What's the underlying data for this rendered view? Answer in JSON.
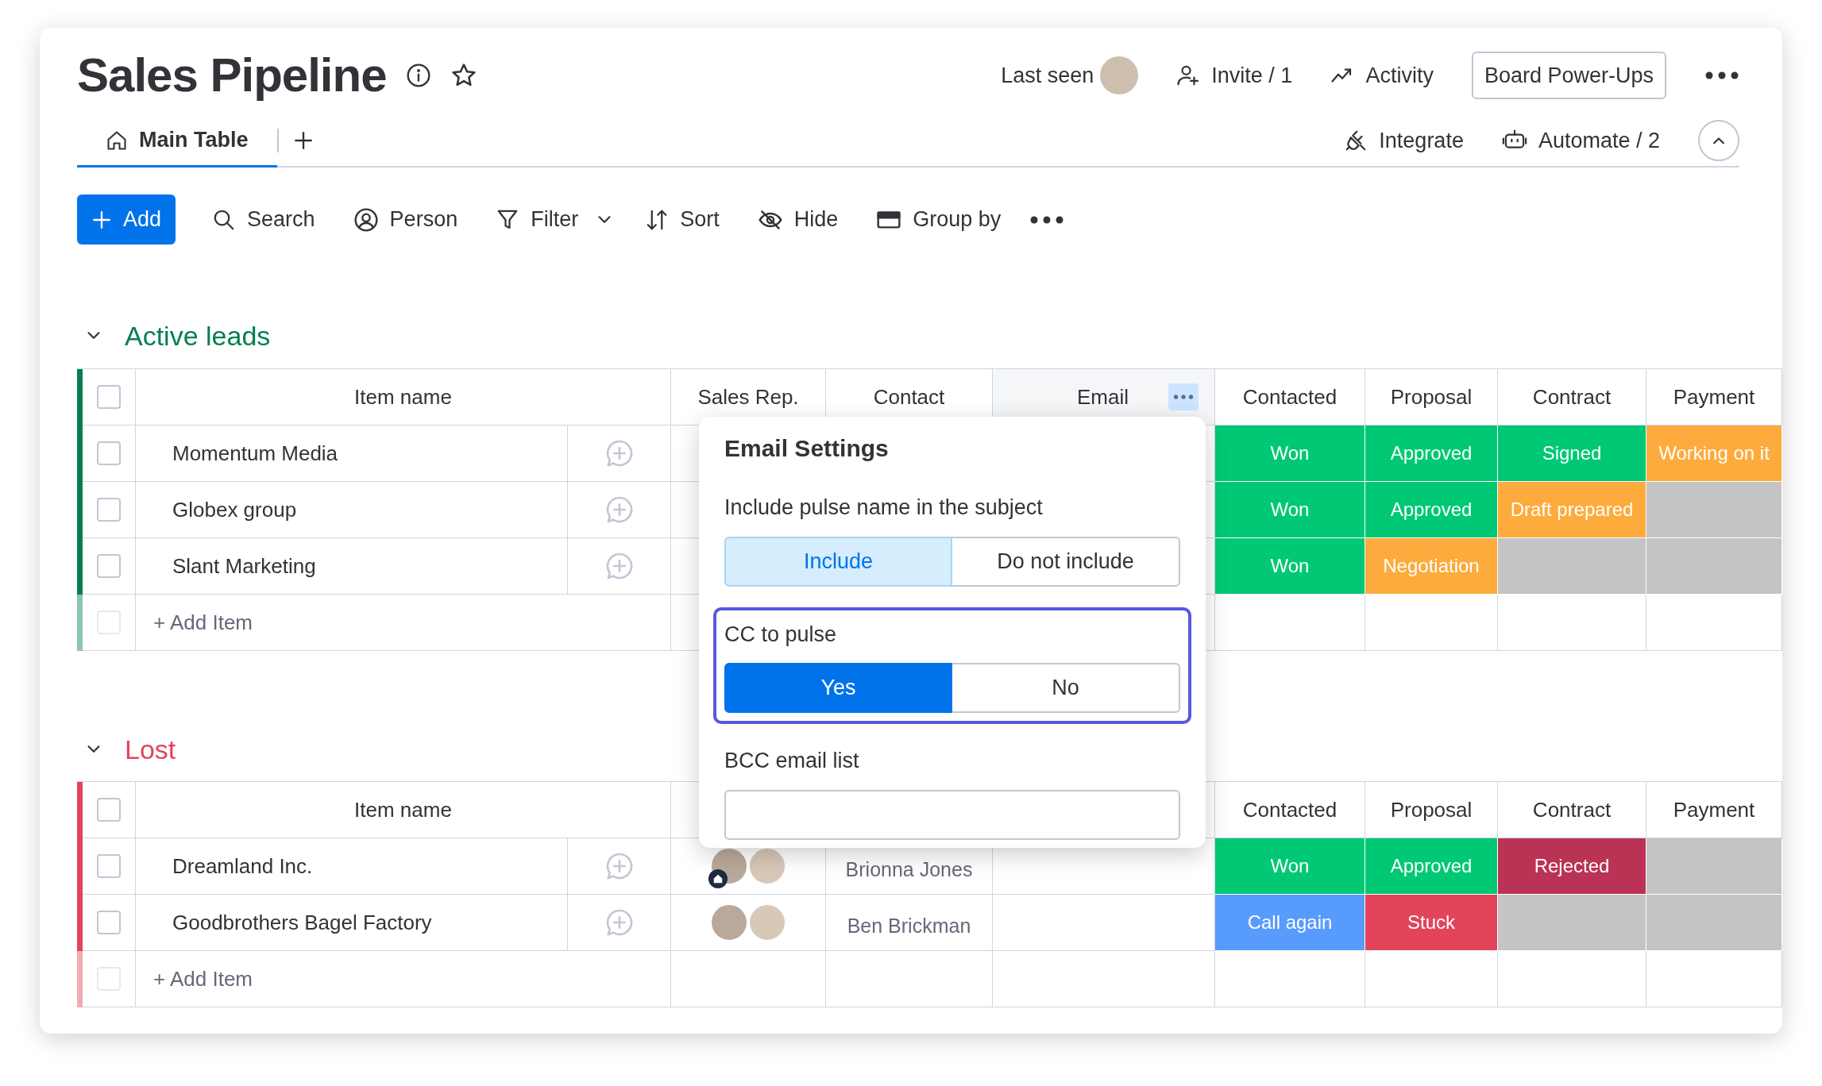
{
  "board": {
    "title": "Sales Pipeline"
  },
  "top_actions": {
    "last_seen": "Last seen",
    "items": [
      {
        "label": "Invite / 1"
      },
      {
        "label": "Activity"
      }
    ],
    "power_ups": "Board Power-Ups"
  },
  "views": [
    {
      "label": "Main Table",
      "selected": true
    }
  ],
  "view_actions": [
    {
      "label": "Integrate"
    },
    {
      "label": "Automate / 2"
    }
  ],
  "toolbar": {
    "add": "Add",
    "items": [
      {
        "label": "Search"
      },
      {
        "label": "Person"
      },
      {
        "label": "Filter"
      },
      {
        "label": "Sort"
      },
      {
        "label": "Hide"
      },
      {
        "label": "Group by"
      }
    ]
  },
  "groups": [
    {
      "title": "Active leads",
      "color": "#037f4c",
      "select_all_checked": false,
      "add_item_checkbox_disabled": true,
      "item_column": "Item name",
      "columns": [
        "Sales Rep.",
        "Contact",
        "Email",
        "Contacted",
        "Proposal",
        "Contract",
        "Payment"
      ],
      "rows": [
        {
          "name": "Momentum Media",
          "checked": false,
          "statuses": [
            {
              "label": "Won",
              "color": "#00c875"
            },
            {
              "label": "Approved",
              "color": "#00c875"
            },
            {
              "label": "Signed",
              "color": "#00c875"
            },
            {
              "label": "Working on it",
              "color": "#fdab3d"
            }
          ]
        },
        {
          "name": "Globex group",
          "checked": false,
          "statuses": [
            {
              "label": "Won",
              "color": "#00c875"
            },
            {
              "label": "Approved",
              "color": "#00c875"
            },
            {
              "label": "Draft prepared",
              "color": "#fdab3d"
            },
            {
              "color": "#c4c4c4"
            }
          ]
        },
        {
          "name": "Slant Marketing",
          "checked": false,
          "statuses": [
            {
              "label": "Won",
              "color": "#00c875"
            },
            {
              "label": "Negotiation",
              "color": "#fdab3d"
            },
            {
              "color": "#c4c4c4"
            },
            {
              "color": "#c4c4c4"
            }
          ]
        }
      ],
      "add_item": "+ Add Item"
    },
    {
      "title": "Lost",
      "color": "#e2445c",
      "select_all_checked": false,
      "add_item_checkbox_disabled": true,
      "item_column": "Item name",
      "columns": [
        "Contacted",
        "Proposal",
        "Contract",
        "Payment"
      ],
      "rows": [
        {
          "name": "Dreamland Inc.",
          "checked": false,
          "avatars": [
            {
              "home_badge": true
            },
            {
              "home_badge": false
            }
          ],
          "contact": "Brionna Jones",
          "statuses": [
            {
              "label": "Won",
              "color": "#00c875"
            },
            {
              "label": "Approved",
              "color": "#00c875"
            },
            {
              "label": "Rejected",
              "color": "#bb3354"
            },
            {
              "color": "#c4c4c4"
            }
          ]
        },
        {
          "name": "Goodbrothers Bagel Factory",
          "checked": false,
          "avatars": [
            {
              "home_badge": false
            },
            {
              "home_badge": false
            }
          ],
          "contact": "Ben Brickman",
          "statuses": [
            {
              "label": "Call again",
              "color": "#579bfc"
            },
            {
              "label": "Stuck",
              "color": "#e2445c"
            },
            {
              "color": "#c4c4c4"
            },
            {
              "color": "#c4c4c4"
            }
          ]
        }
      ],
      "add_item": "+ Add Item"
    }
  ],
  "email_settings": {
    "title": "Email Settings",
    "sections": [
      {
        "kind": "segmented",
        "label": "Include pulse name in the subject",
        "focused": false,
        "options": [
          {
            "label": "Include",
            "selected": true
          },
          {
            "label": "Do not include",
            "selected": false
          }
        ]
      },
      {
        "kind": "segmented",
        "label": "CC to pulse",
        "focused": true,
        "options": [
          {
            "label": "Yes",
            "selected": true
          },
          {
            "label": "No",
            "selected": false
          }
        ]
      },
      {
        "kind": "input",
        "label": "BCC email list",
        "focused": false
      }
    ]
  }
}
